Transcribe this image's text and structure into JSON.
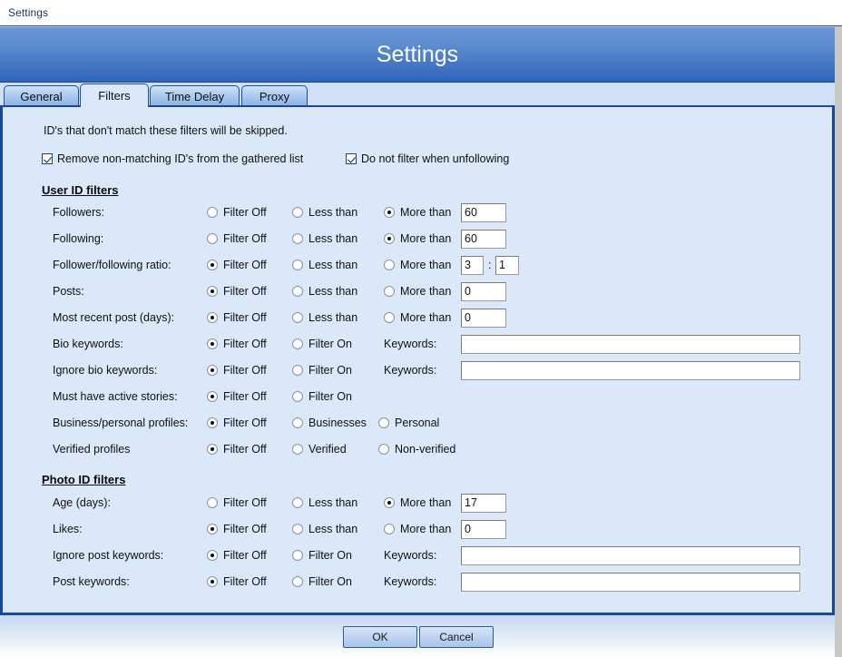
{
  "window": {
    "title": "Settings"
  },
  "banner": {
    "title": "Settings"
  },
  "tabs": [
    {
      "label": "General",
      "active": false
    },
    {
      "label": "Filters",
      "active": true
    },
    {
      "label": "Time Delay",
      "active": false
    },
    {
      "label": "Proxy",
      "active": false
    }
  ],
  "content": {
    "hint": "ID's that don't match these filters will be skipped.",
    "checkboxes": [
      {
        "label": "Remove non-matching ID's from the gathered list",
        "checked": true
      },
      {
        "label": "Do not filter when unfollowing",
        "checked": true
      }
    ],
    "sections": [
      {
        "heading": "User ID filters"
      },
      {
        "heading": "Photo ID filters"
      }
    ],
    "user_id_filters": [
      {
        "label": "Followers:",
        "options": [
          "Filter Off",
          "Less than",
          "More than"
        ],
        "selected": 2,
        "value": "60"
      },
      {
        "label": "Following:",
        "options": [
          "Filter Off",
          "Less than",
          "More than"
        ],
        "selected": 2,
        "value": "60"
      },
      {
        "label": "Follower/following ratio:",
        "options": [
          "Filter Off",
          "Less than",
          "More than"
        ],
        "selected": 0,
        "value": "3",
        "value2": "1",
        "separator": ":"
      },
      {
        "label": "Posts:",
        "options": [
          "Filter Off",
          "Less than",
          "More than"
        ],
        "selected": 0,
        "value": "0"
      },
      {
        "label": "Most recent post (days):",
        "options": [
          "Filter Off",
          "Less than",
          "More than"
        ],
        "selected": 0,
        "value": "0"
      },
      {
        "label": "Bio keywords:",
        "options": [
          "Filter Off",
          "Filter On"
        ],
        "selected": 0,
        "keywords_label": "Keywords:",
        "keywords_value": ""
      },
      {
        "label": "Ignore bio keywords:",
        "options": [
          "Filter Off",
          "Filter On"
        ],
        "selected": 0,
        "keywords_label": "Keywords:",
        "keywords_value": ""
      },
      {
        "label": "Must have active stories:",
        "options": [
          "Filter Off",
          "Filter On"
        ],
        "selected": 0
      },
      {
        "label": "Business/personal profiles:",
        "options": [
          "Filter Off",
          "Businesses",
          "Personal"
        ],
        "selected": 0
      },
      {
        "label": "Verified profiles",
        "options": [
          "Filter Off",
          "Verified",
          "Non-verified"
        ],
        "selected": 0
      }
    ],
    "photo_id_filters": [
      {
        "label": "Age (days):",
        "options": [
          "Filter Off",
          "Less than",
          "More than"
        ],
        "selected": 2,
        "value": "17"
      },
      {
        "label": "Likes:",
        "options": [
          "Filter Off",
          "Less than",
          "More than"
        ],
        "selected": 0,
        "value": "0"
      },
      {
        "label": "Ignore post keywords:",
        "options": [
          "Filter Off",
          "Filter On"
        ],
        "selected": 0,
        "keywords_label": "Keywords:",
        "keywords_value": ""
      },
      {
        "label": "Post keywords:",
        "options": [
          "Filter Off",
          "Filter On"
        ],
        "selected": 0,
        "keywords_label": "Keywords:",
        "keywords_value": ""
      }
    ]
  },
  "footer": {
    "ok_label": "OK",
    "cancel_label": "Cancel"
  },
  "colors": {
    "banner_start": "#6b96d6",
    "banner_end": "#2f64b8",
    "panel_bg": "#dbe8fa",
    "panel_border": "#17489e",
    "tab_active_bg": "#dbe8fa",
    "title_text": "#17365d"
  }
}
